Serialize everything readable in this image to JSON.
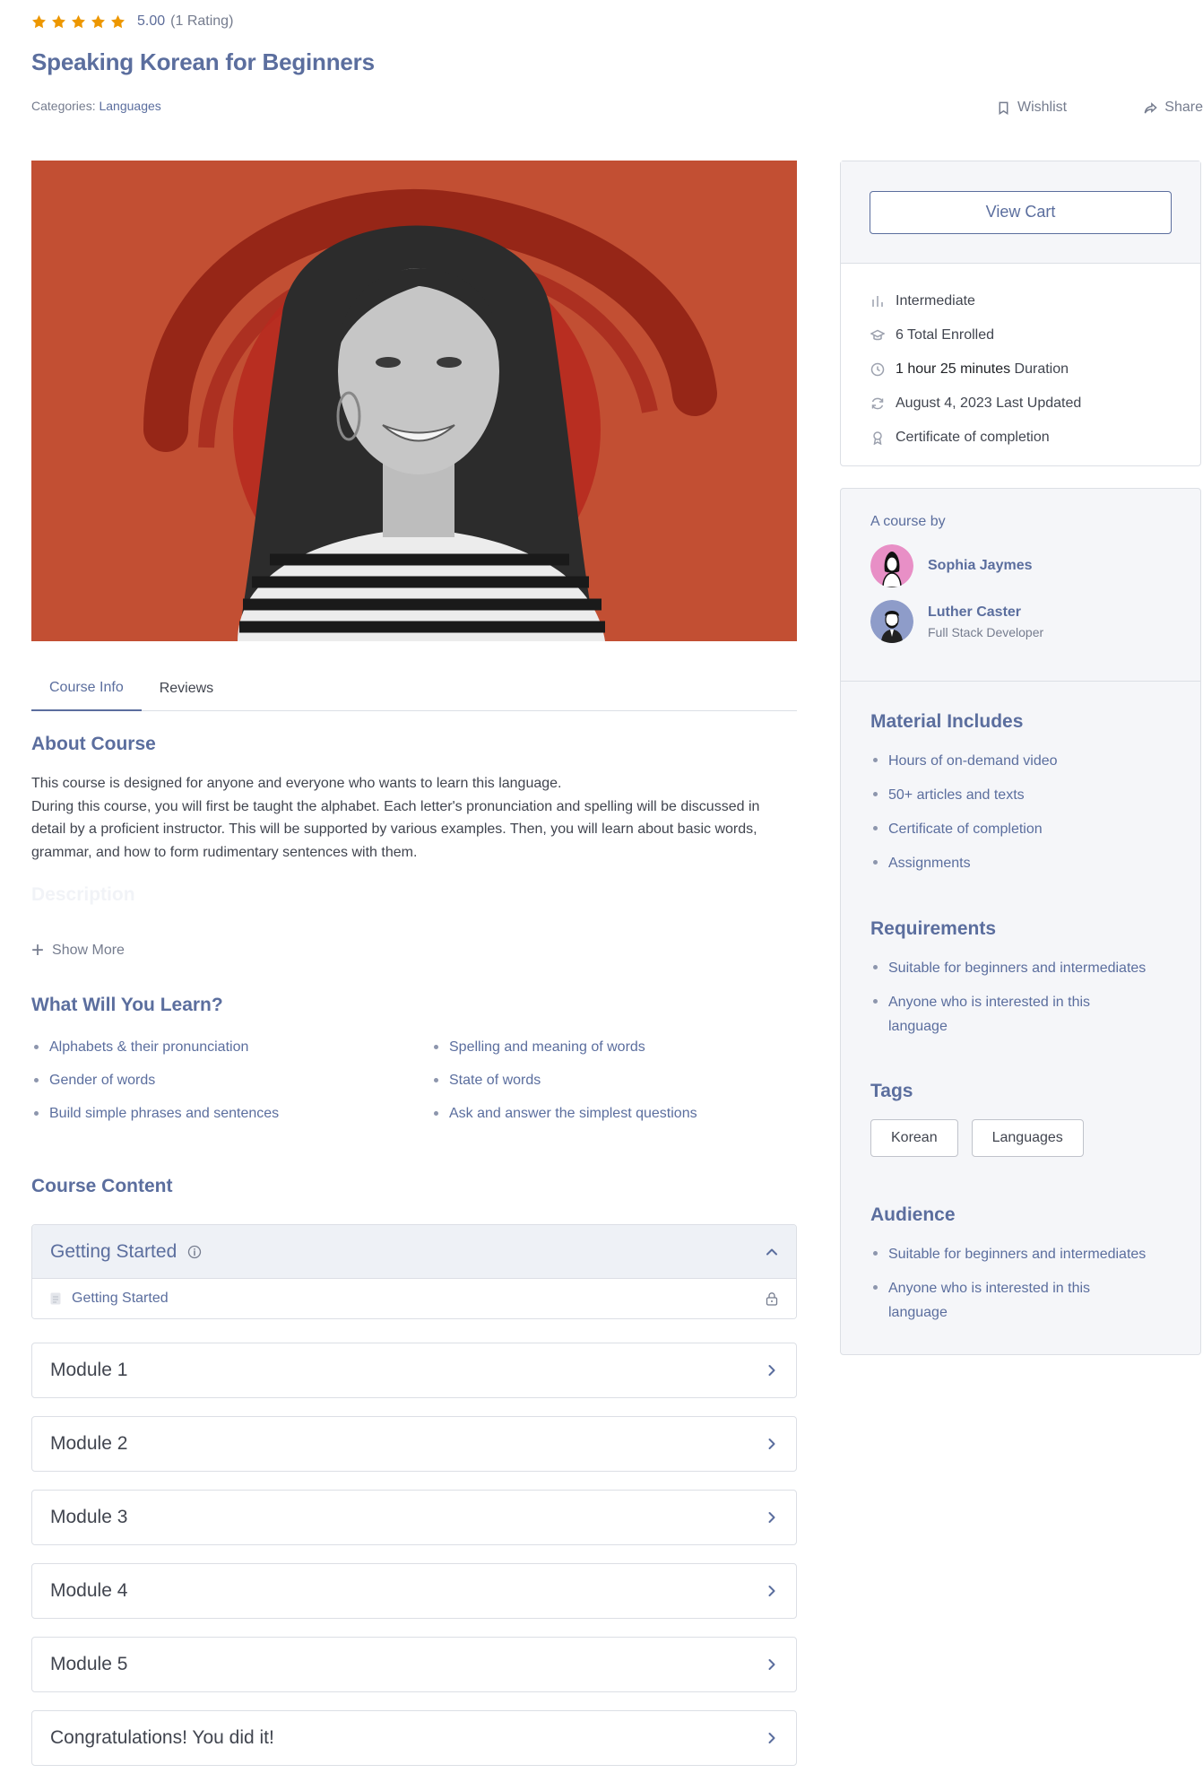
{
  "rating": {
    "value": "5.00",
    "count": "(1 Rating)",
    "stars": 5,
    "star_color": "#ED9700"
  },
  "course": {
    "title": "Speaking Korean for Beginners",
    "categories_label": "Categories:",
    "category": "Languages"
  },
  "actions": {
    "wishlist": "Wishlist",
    "share": "Share"
  },
  "hero": {
    "alt": "Smiling woman in striped shirt on red ink-swirl background",
    "bg_color": "#C24F33"
  },
  "tabs": [
    {
      "label": "Course Info",
      "active": true
    },
    {
      "label": "Reviews",
      "active": false
    }
  ],
  "about": {
    "heading": "About Course",
    "text_line1": "This course is designed for anyone and everyone who wants to learn this language.",
    "text_line2": "During this course, you will first be taught the alphabet. Each letter's pronunciation and spelling will be discussed in detail by a proficient instructor. This will be supported by various examples. Then, you will learn about basic words, grammar, and how to form rudimentary sentences with them.",
    "description_heading": "Description",
    "show_more": "Show More"
  },
  "learn": {
    "heading": "What Will You Learn?",
    "items": [
      "Alphabets & their pronunciation",
      "Spelling and meaning of words",
      "Gender of words",
      "State of words",
      "Build simple phrases and sentences",
      "Ask and answer the simplest questions"
    ]
  },
  "content": {
    "heading": "Course Content",
    "open_topic": {
      "title": "Getting Started",
      "lesson": "Getting Started"
    },
    "modules": [
      "Module 1",
      "Module 2",
      "Module 3",
      "Module 4",
      "Module 5",
      "Congratulations! You did it!"
    ]
  },
  "sidebar": {
    "view_cart": "View Cart",
    "level": "Intermediate",
    "enrolled": "6 Total Enrolled",
    "duration": {
      "hour": "1 hour",
      "minutes": "25 minutes",
      "label": "Duration"
    },
    "last_updated": "August 4, 2023 Last Updated",
    "certificate": "Certificate of completion",
    "by_label": "A course by",
    "instructors": [
      {
        "name": "Sophia Jaymes",
        "role": ""
      },
      {
        "name": "Luther Caster",
        "role": "Full Stack Developer"
      }
    ],
    "material_heading": "Material Includes",
    "materials": [
      "Hours of on-demand video",
      "50+ articles and texts",
      "Certificate of completion",
      "Assignments"
    ],
    "requirements_heading": "Requirements",
    "requirements": [
      "Suitable for beginners and intermediates",
      "Anyone who is interested in this language"
    ],
    "tags_heading": "Tags",
    "tags": [
      "Korean",
      "Languages"
    ],
    "audience_heading": "Audience",
    "audience": [
      "Suitable for beginners and intermediates",
      "Anyone who is interested in this language"
    ]
  },
  "colors": {
    "accent": "#5B6E9E",
    "border": "#DCDFE5",
    "text": "#41454F",
    "muted": "#757C8E"
  }
}
